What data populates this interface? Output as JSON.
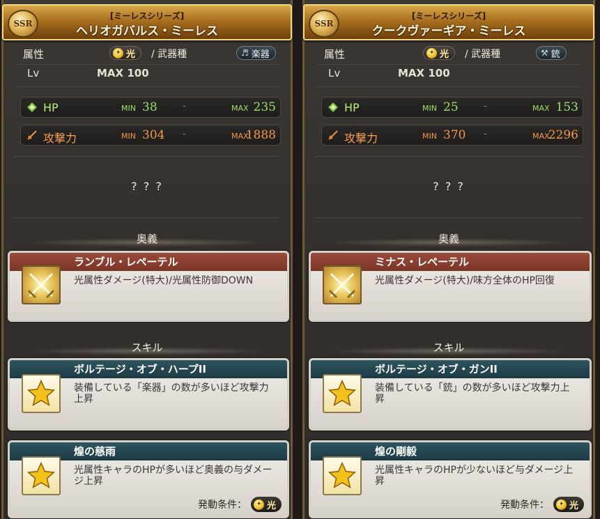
{
  "panels": [
    {
      "rarity": "SSR",
      "series": "[ミーレスシリーズ]",
      "name": "ヘリオガバルス・ミーレス",
      "attribute_label": "属性",
      "element": "光",
      "weapon_type_label": "/ 武器種",
      "weapon_type": "楽器",
      "weapon_type_icon": "instrument-icon",
      "lv_label": "Lv",
      "lv_value": "MAX 100",
      "hp": {
        "label": "HP",
        "min_label": "MIN",
        "min": "38",
        "dash": "-",
        "max_label": "MAX",
        "max": "235"
      },
      "atk": {
        "label": "攻撃力",
        "min_label": "MIN",
        "min": "304",
        "dash": "-",
        "max_label": "MAX",
        "max": "1888"
      },
      "unknown": "? ? ?",
      "ougi_title": "奥義",
      "ougi": {
        "name": "ランブル・レペーテル",
        "desc": "光属性ダメージ(特大)/光属性防御DOWN"
      },
      "skill_title": "スキル",
      "skills": [
        {
          "name": "ボルテージ・オブ・ハープII",
          "desc": "装備している「楽器」の数が多いほど攻撃力上昇"
        },
        {
          "name": "煌の慈雨",
          "desc": "光属性キャラのHPが多いほど奥義の与ダメージ上昇",
          "condition_label": "発動条件：",
          "condition": "光"
        }
      ]
    },
    {
      "rarity": "SSR",
      "series": "[ミーレスシリーズ]",
      "name": "クークヴァーギア・ミーレス",
      "attribute_label": "属性",
      "element": "光",
      "weapon_type_label": "/ 武器種",
      "weapon_type": "銃",
      "weapon_type_icon": "gun-icon",
      "lv_label": "Lv",
      "lv_value": "MAX 100",
      "hp": {
        "label": "HP",
        "min_label": "MIN",
        "min": "25",
        "dash": "-",
        "max_label": "MAX",
        "max": "153"
      },
      "atk": {
        "label": "攻撃力",
        "min_label": "MIN",
        "min": "370",
        "dash": "-",
        "max_label": "MAX",
        "max": "2296"
      },
      "unknown": "? ? ?",
      "ougi_title": "奥義",
      "ougi": {
        "name": "ミナス・レペーテル",
        "desc": "光属性ダメージ(特大)/味方全体のHP回復"
      },
      "skill_title": "スキル",
      "skills": [
        {
          "name": "ボルテージ・オブ・ガンII",
          "desc": "装備している「銃」の数が多いほど攻撃力上昇"
        },
        {
          "name": "煌の剛毅",
          "desc": "光属性キャラのHPが少ないほど与ダメージ上昇",
          "condition_label": "発動条件：",
          "condition": "光"
        }
      ]
    }
  ]
}
